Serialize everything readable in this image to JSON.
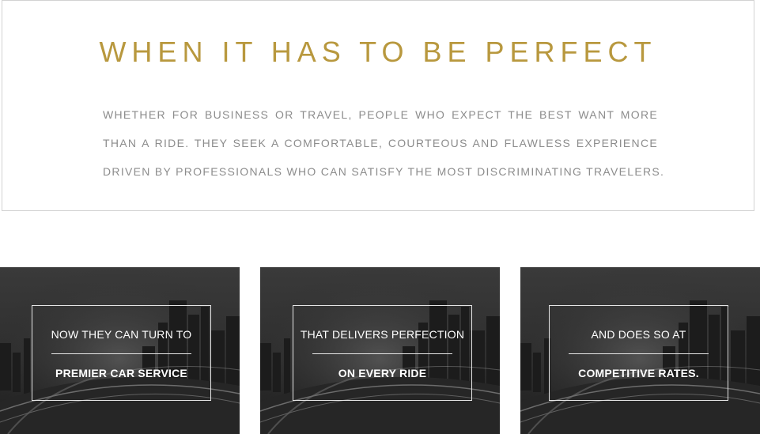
{
  "intro": {
    "headline": "WHEN IT HAS TO BE PERFECT",
    "lines": [
      "WHETHER FOR BUSINESS OR TRAVEL, PEOPLE WHO EXPECT THE BEST WANT MORE",
      "THAN A RIDE. THEY SEEK A COMFORTABLE, COURTEOUS AND FLAWLESS EXPERIENCE",
      "DRIVEN BY PROFESSIONALS WHO CAN SATISFY THE MOST DISCRIMINATING TRAVELERS."
    ]
  },
  "cards": [
    {
      "line1": "NOW THEY CAN TURN TO",
      "line2": "PREMIER CAR SERVICE"
    },
    {
      "line1": "THAT DELIVERS PERFECTION",
      "line2": "ON EVERY RIDE"
    },
    {
      "line1": "AND DOES SO AT",
      "line2": "COMPETITIVE RATES."
    }
  ],
  "colors": {
    "accent": "#b8983e",
    "body_text": "#8c8c8c",
    "card_text": "#ffffff"
  }
}
